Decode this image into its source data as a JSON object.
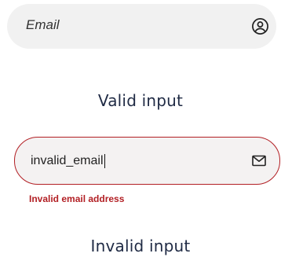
{
  "valid_example": {
    "placeholder": "Email",
    "icon": "user-circle-icon",
    "caption": "Valid input"
  },
  "invalid_example": {
    "value": "invalid_email",
    "icon": "envelope-icon",
    "error_message": "Invalid email address",
    "caption": "Invalid input"
  },
  "colors": {
    "error": "#b21f24",
    "caption_text": "#1f2a44",
    "field_background": "#f1f1f1"
  }
}
